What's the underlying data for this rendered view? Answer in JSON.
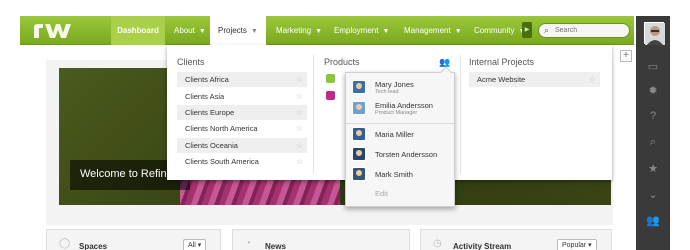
{
  "nav": {
    "logo": "rw",
    "items": [
      {
        "label": "Dashboard"
      },
      {
        "label": "About"
      },
      {
        "label": "Projects"
      },
      {
        "label": "Marketing"
      },
      {
        "label": "Employment"
      },
      {
        "label": "Management"
      },
      {
        "label": "Community"
      }
    ],
    "search_placeholder": "Search"
  },
  "dropdown": {
    "clients": {
      "heading": "Clients",
      "items": [
        "Clients Africa",
        "Clients Asia",
        "Clients Europe",
        "Clients North America",
        "Clients Oceania",
        "Clients South America"
      ]
    },
    "products": {
      "heading": "Products"
    },
    "internal": {
      "heading": "Internal Projects",
      "items": [
        "Acme Website"
      ]
    }
  },
  "people_popup": {
    "people": [
      {
        "name": "Mary Jones",
        "role": "Tech lead"
      },
      {
        "name": "Emilia Andersson",
        "role": "Product Manager"
      },
      {
        "name": "Maria Miller",
        "role": ""
      },
      {
        "name": "Torsten Andersson",
        "role": ""
      },
      {
        "name": "Mark Smith",
        "role": ""
      }
    ],
    "edit_label": "Edit"
  },
  "hero": {
    "title": "Welcome to Refin"
  },
  "bottom_cards": [
    {
      "title": "Spaces",
      "select": "All"
    },
    {
      "title": "News",
      "select": ""
    },
    {
      "title": "Activity Stream",
      "select": "Popular"
    }
  ],
  "colors": {
    "nav_green": "#7aa91f",
    "dashboard_tab": "#a9d048",
    "sidebar_dark": "#3a3a3a",
    "product_green": "#8cc63f",
    "product_pink": "#c0288a"
  }
}
